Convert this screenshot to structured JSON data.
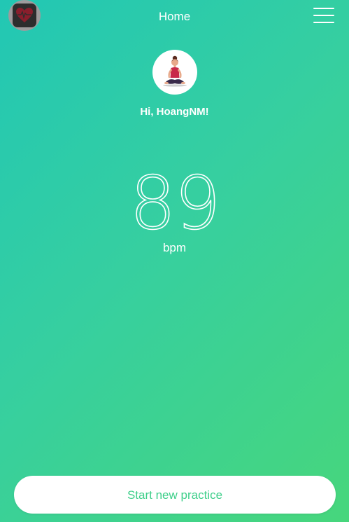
{
  "header": {
    "title": "Home",
    "app_icon": "heart-rate-app-icon",
    "menu_icon": "hamburger-menu-icon"
  },
  "profile": {
    "avatar_icon": "yoga-meditation-avatar",
    "greeting": "Hi, HoangNM!"
  },
  "heart_rate": {
    "value": "89",
    "unit": "bpm"
  },
  "actions": {
    "start_label": "Start new practice"
  },
  "colors": {
    "gradient_start": "#22c7b4",
    "gradient_end": "#47d67c",
    "button_text": "#3ecf8a"
  }
}
